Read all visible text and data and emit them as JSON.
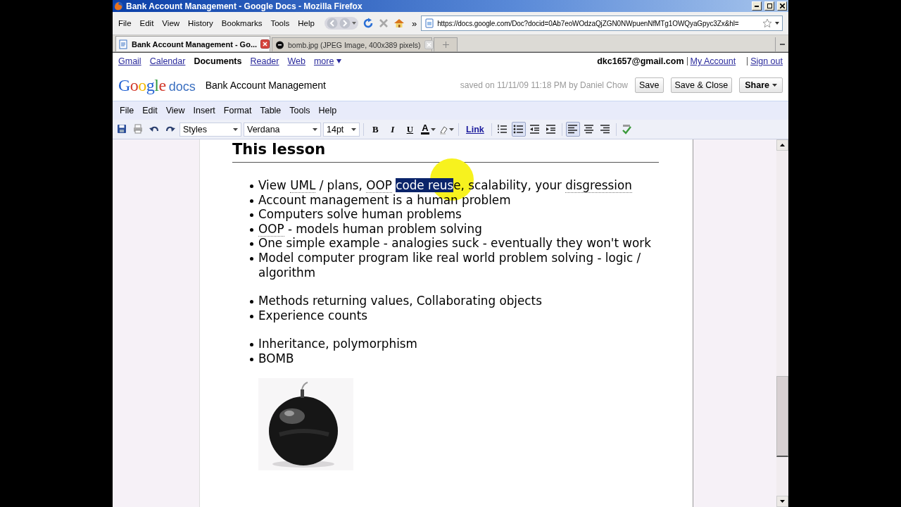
{
  "window": {
    "title": "Bank Account Management - Google Docs - Mozilla Firefox"
  },
  "browser_menu": [
    "File",
    "Edit",
    "View",
    "History",
    "Bookmarks",
    "Tools",
    "Help"
  ],
  "nav": {
    "overflow": "»",
    "url": "https://docs.google.com/Doc?docid=0Ab7eoWOdzaQjZGN0NWpuenNfMTg1OWQyaGpyc3Zx&hl="
  },
  "tabs": [
    {
      "label": "Bank Account Management - Go...",
      "selected": true,
      "kind": "doc"
    },
    {
      "label": "bomb.jpg (JPEG Image, 400x389 pixels)",
      "selected": false
    }
  ],
  "google_bar": {
    "links": [
      {
        "label": "Gmail",
        "selected": false
      },
      {
        "label": "Calendar",
        "selected": false
      },
      {
        "label": "Documents",
        "selected": true
      },
      {
        "label": "Reader",
        "selected": false
      },
      {
        "label": "Web",
        "selected": false
      }
    ],
    "more": "more",
    "user": "dkc1657@gmail.com",
    "account_links": [
      "My Account",
      "Sign out"
    ]
  },
  "header": {
    "logo": "Google",
    "product": "docs",
    "doc_title": "Bank Account Management",
    "saved": "saved on 11/11/09 11:18 PM by Daniel Chow",
    "buttons": [
      "Save",
      "Save & Close"
    ],
    "share": "Share"
  },
  "app_menu": [
    "File",
    "Edit",
    "View",
    "Insert",
    "Format",
    "Table",
    "Tools",
    "Help"
  ],
  "toolbar": [
    {
      "kind": "save"
    },
    {
      "kind": "print"
    },
    {
      "kind": "undo"
    },
    {
      "kind": "redo"
    },
    {
      "kind": "dropdown",
      "label": "Styles"
    },
    {
      "kind": "dropdown",
      "label": "Verdana"
    },
    {
      "kind": "dropdown",
      "label": "14pt"
    },
    {
      "kind": "separator"
    },
    {
      "kind": "bold",
      "label": "B"
    },
    {
      "kind": "italic",
      "label": "I"
    },
    {
      "kind": "underline",
      "label": "U"
    },
    {
      "kind": "text-color",
      "label": "A"
    },
    {
      "kind": "highlight"
    },
    {
      "kind": "separator"
    },
    {
      "kind": "link",
      "label": "Link"
    },
    {
      "kind": "separator"
    },
    {
      "kind": "numbered-list",
      "selected": false
    },
    {
      "kind": "bulleted-list",
      "selected": true
    },
    {
      "kind": "outdent"
    },
    {
      "kind": "indent"
    },
    {
      "kind": "separator"
    },
    {
      "kind": "align-left",
      "selected": true
    },
    {
      "kind": "align-center",
      "selected": false
    },
    {
      "kind": "align-right",
      "selected": false
    },
    {
      "kind": "separator"
    },
    {
      "kind": "spellcheck"
    }
  ],
  "document": {
    "heading": "This lesson",
    "lists": [
      {
        "items": [
          {
            "segments": [
              {
                "text": "View "
              },
              {
                "text": "UML",
                "flagged": true
              },
              {
                "text": " / plans, "
              },
              {
                "text": "OOP",
                "flagged": true
              },
              {
                "text": " code reus",
                "selected": true
              },
              {
                "text": "e, scalability, your "
              },
              {
                "text": "disgression",
                "flagged": true
              }
            ]
          },
          {
            "segments": [
              {
                "text": "Account management is a human problem"
              }
            ]
          },
          {
            "segments": [
              {
                "text": "Computers solve human problems"
              }
            ]
          },
          {
            "segments": [
              {
                "text": "OOP",
                "flagged": true
              },
              {
                "text": " - models human problem solving"
              }
            ]
          },
          {
            "segments": [
              {
                "text": "One simple example - analogies suck - eventually they won't work"
              }
            ]
          },
          {
            "segments": [
              {
                "text": "Model computer program like real world problem solving - logic / algorithm"
              }
            ]
          }
        ]
      },
      {
        "items": [
          {
            "segments": [
              {
                "text": "Methods returning values, Collaborating objects"
              }
            ]
          },
          {
            "segments": [
              {
                "text": "Experience counts"
              }
            ]
          }
        ]
      },
      {
        "items": [
          {
            "segments": [
              {
                "text": "Inheritance, polymorphism"
              }
            ]
          },
          {
            "segments": [
              {
                "text": "BOMB"
              }
            ]
          }
        ]
      }
    ]
  }
}
